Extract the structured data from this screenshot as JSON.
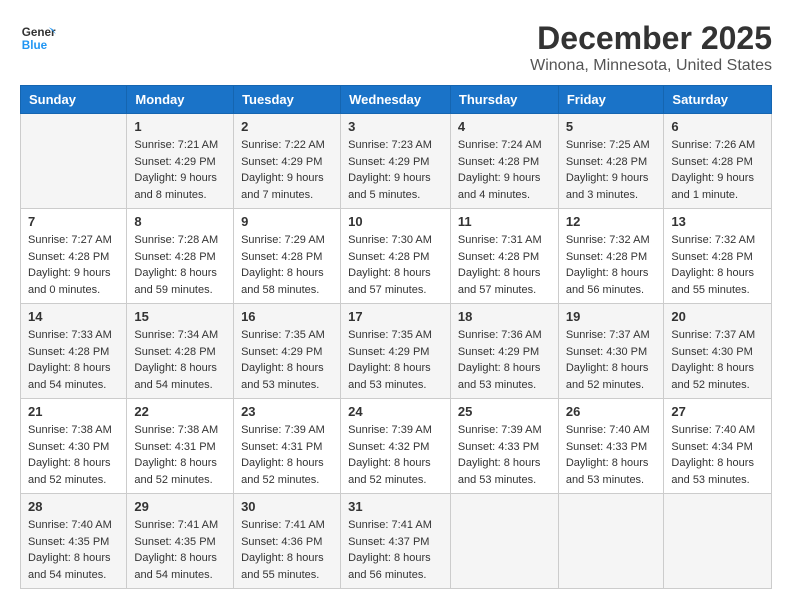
{
  "header": {
    "logo_line1": "General",
    "logo_line2": "Blue",
    "title": "December 2025",
    "subtitle": "Winona, Minnesota, United States"
  },
  "days_of_week": [
    "Sunday",
    "Monday",
    "Tuesday",
    "Wednesday",
    "Thursday",
    "Friday",
    "Saturday"
  ],
  "weeks": [
    [
      {
        "num": "",
        "info": ""
      },
      {
        "num": "1",
        "info": "Sunrise: 7:21 AM\nSunset: 4:29 PM\nDaylight: 9 hours\nand 8 minutes."
      },
      {
        "num": "2",
        "info": "Sunrise: 7:22 AM\nSunset: 4:29 PM\nDaylight: 9 hours\nand 7 minutes."
      },
      {
        "num": "3",
        "info": "Sunrise: 7:23 AM\nSunset: 4:29 PM\nDaylight: 9 hours\nand 5 minutes."
      },
      {
        "num": "4",
        "info": "Sunrise: 7:24 AM\nSunset: 4:28 PM\nDaylight: 9 hours\nand 4 minutes."
      },
      {
        "num": "5",
        "info": "Sunrise: 7:25 AM\nSunset: 4:28 PM\nDaylight: 9 hours\nand 3 minutes."
      },
      {
        "num": "6",
        "info": "Sunrise: 7:26 AM\nSunset: 4:28 PM\nDaylight: 9 hours\nand 1 minute."
      }
    ],
    [
      {
        "num": "7",
        "info": "Sunrise: 7:27 AM\nSunset: 4:28 PM\nDaylight: 9 hours\nand 0 minutes."
      },
      {
        "num": "8",
        "info": "Sunrise: 7:28 AM\nSunset: 4:28 PM\nDaylight: 8 hours\nand 59 minutes."
      },
      {
        "num": "9",
        "info": "Sunrise: 7:29 AM\nSunset: 4:28 PM\nDaylight: 8 hours\nand 58 minutes."
      },
      {
        "num": "10",
        "info": "Sunrise: 7:30 AM\nSunset: 4:28 PM\nDaylight: 8 hours\nand 57 minutes."
      },
      {
        "num": "11",
        "info": "Sunrise: 7:31 AM\nSunset: 4:28 PM\nDaylight: 8 hours\nand 57 minutes."
      },
      {
        "num": "12",
        "info": "Sunrise: 7:32 AM\nSunset: 4:28 PM\nDaylight: 8 hours\nand 56 minutes."
      },
      {
        "num": "13",
        "info": "Sunrise: 7:32 AM\nSunset: 4:28 PM\nDaylight: 8 hours\nand 55 minutes."
      }
    ],
    [
      {
        "num": "14",
        "info": "Sunrise: 7:33 AM\nSunset: 4:28 PM\nDaylight: 8 hours\nand 54 minutes."
      },
      {
        "num": "15",
        "info": "Sunrise: 7:34 AM\nSunset: 4:28 PM\nDaylight: 8 hours\nand 54 minutes."
      },
      {
        "num": "16",
        "info": "Sunrise: 7:35 AM\nSunset: 4:29 PM\nDaylight: 8 hours\nand 53 minutes."
      },
      {
        "num": "17",
        "info": "Sunrise: 7:35 AM\nSunset: 4:29 PM\nDaylight: 8 hours\nand 53 minutes."
      },
      {
        "num": "18",
        "info": "Sunrise: 7:36 AM\nSunset: 4:29 PM\nDaylight: 8 hours\nand 53 minutes."
      },
      {
        "num": "19",
        "info": "Sunrise: 7:37 AM\nSunset: 4:30 PM\nDaylight: 8 hours\nand 52 minutes."
      },
      {
        "num": "20",
        "info": "Sunrise: 7:37 AM\nSunset: 4:30 PM\nDaylight: 8 hours\nand 52 minutes."
      }
    ],
    [
      {
        "num": "21",
        "info": "Sunrise: 7:38 AM\nSunset: 4:30 PM\nDaylight: 8 hours\nand 52 minutes."
      },
      {
        "num": "22",
        "info": "Sunrise: 7:38 AM\nSunset: 4:31 PM\nDaylight: 8 hours\nand 52 minutes."
      },
      {
        "num": "23",
        "info": "Sunrise: 7:39 AM\nSunset: 4:31 PM\nDaylight: 8 hours\nand 52 minutes."
      },
      {
        "num": "24",
        "info": "Sunrise: 7:39 AM\nSunset: 4:32 PM\nDaylight: 8 hours\nand 52 minutes."
      },
      {
        "num": "25",
        "info": "Sunrise: 7:39 AM\nSunset: 4:33 PM\nDaylight: 8 hours\nand 53 minutes."
      },
      {
        "num": "26",
        "info": "Sunrise: 7:40 AM\nSunset: 4:33 PM\nDaylight: 8 hours\nand 53 minutes."
      },
      {
        "num": "27",
        "info": "Sunrise: 7:40 AM\nSunset: 4:34 PM\nDaylight: 8 hours\nand 53 minutes."
      }
    ],
    [
      {
        "num": "28",
        "info": "Sunrise: 7:40 AM\nSunset: 4:35 PM\nDaylight: 8 hours\nand 54 minutes."
      },
      {
        "num": "29",
        "info": "Sunrise: 7:41 AM\nSunset: 4:35 PM\nDaylight: 8 hours\nand 54 minutes."
      },
      {
        "num": "30",
        "info": "Sunrise: 7:41 AM\nSunset: 4:36 PM\nDaylight: 8 hours\nand 55 minutes."
      },
      {
        "num": "31",
        "info": "Sunrise: 7:41 AM\nSunset: 4:37 PM\nDaylight: 8 hours\nand 56 minutes."
      },
      {
        "num": "",
        "info": ""
      },
      {
        "num": "",
        "info": ""
      },
      {
        "num": "",
        "info": ""
      }
    ]
  ]
}
